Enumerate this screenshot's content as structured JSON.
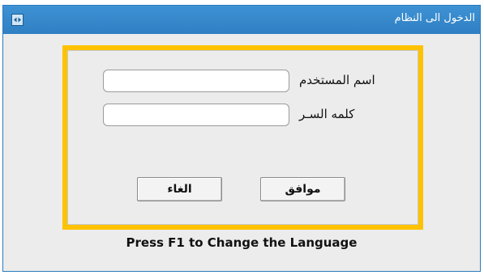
{
  "window": {
    "title": "الدخول الى النظام",
    "icon": "app-icon"
  },
  "form": {
    "username_label": "اسم المستخدم",
    "username_value": "",
    "password_label": "كلمه السـر",
    "password_value": ""
  },
  "buttons": {
    "ok_label": "موافق",
    "cancel_label": "الغاء"
  },
  "footer": {
    "hint": "Press F1 to Change the Language"
  },
  "colors": {
    "titlebar": "#2f7fc3",
    "frame": "#ffc200",
    "panel": "#ececec"
  }
}
